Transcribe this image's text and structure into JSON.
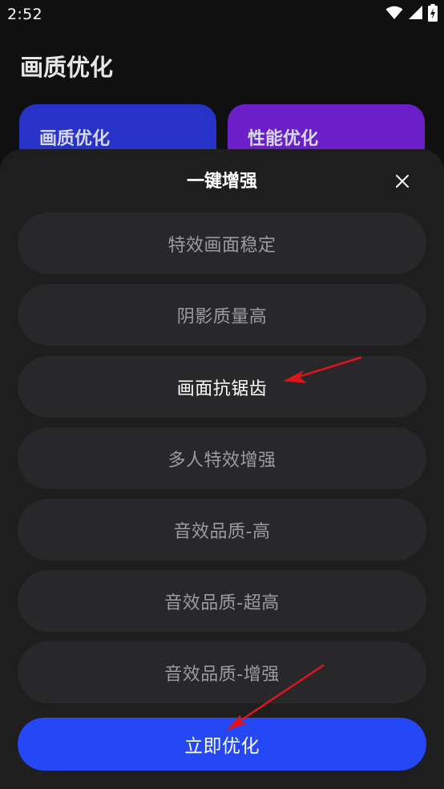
{
  "status_bar": {
    "time": "2:52",
    "icons": [
      "wifi-icon",
      "cellular-signal-icon",
      "battery-charging-icon"
    ]
  },
  "page": {
    "title": "画质优化"
  },
  "cards": [
    {
      "label": "画质优化",
      "color": "#2732c8"
    },
    {
      "label": "性能优化",
      "color": "#6a1fc8"
    }
  ],
  "sheet": {
    "title": "一键增强",
    "close_icon": "close-icon",
    "options": [
      {
        "label": "特效画面稳定",
        "selected": false
      },
      {
        "label": "阴影质量高",
        "selected": false
      },
      {
        "label": "画面抗锯齿",
        "selected": true
      },
      {
        "label": "多人特效增强",
        "selected": false
      },
      {
        "label": "音效品质-高",
        "selected": false
      },
      {
        "label": "音效品质-超高",
        "selected": false
      },
      {
        "label": "音效品质-增强",
        "selected": false
      }
    ],
    "primary_button": "立即优化"
  },
  "annotation_color": "#e0141a",
  "colors": {
    "background": "#101011",
    "sheet": "#1e1e1f",
    "option": "#28282a",
    "accent": "#2448f5"
  }
}
